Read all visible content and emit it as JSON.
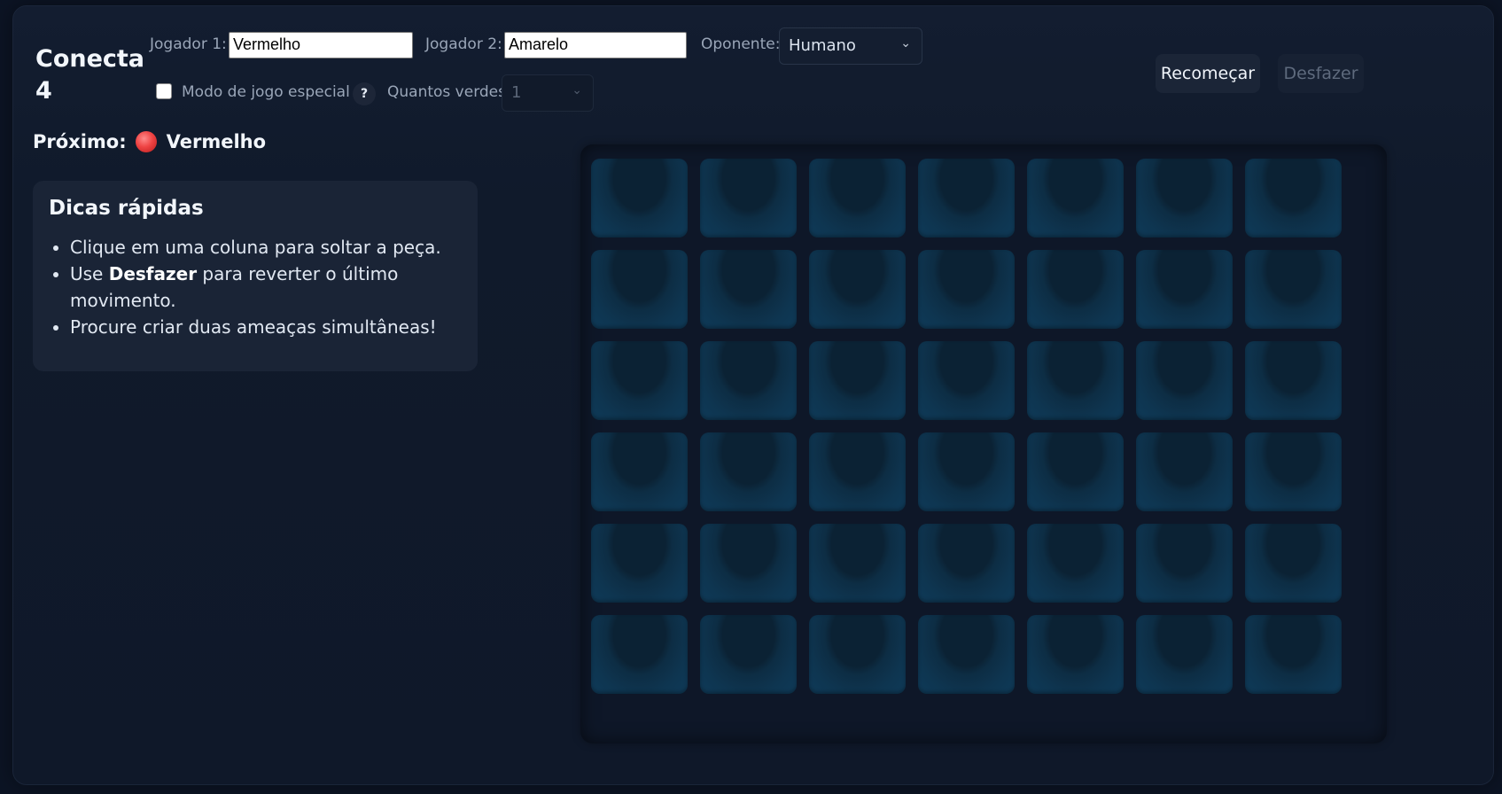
{
  "app": {
    "title": "Conecta 4"
  },
  "controls": {
    "player1_label": "Jogador 1:",
    "player1_value": "Vermelho",
    "player2_label": "Jogador 2:",
    "player2_value": "Amarelo",
    "opponent_label": "Oponente:",
    "opponent_value": "Humano",
    "special_mode_label": "Modo de jogo especial",
    "special_mode_checked": false,
    "help_label": "?",
    "greens_label": "Quantos verdes:",
    "greens_value": "1"
  },
  "buttons": {
    "restart_label": "Recomeçar",
    "undo_label": "Desfazer"
  },
  "status": {
    "next_label": "Próximo:",
    "next_player": "Vermelho",
    "next_color": "#ef4444"
  },
  "tips": {
    "title": "Dicas rápidas",
    "item1": "Clique em uma coluna para soltar a peça.",
    "item2_prefix": "Use ",
    "item2_bold": "Desfazer",
    "item2_suffix": " para reverter o último movimento.",
    "item3": "Procure criar duas ameaças simultâneas!"
  },
  "board": {
    "rows": 6,
    "columns": 7,
    "cells": [
      [
        "",
        "",
        "",
        "",
        "",
        "",
        ""
      ],
      [
        "",
        "",
        "",
        "",
        "",
        "",
        ""
      ],
      [
        "",
        "",
        "",
        "",
        "",
        "",
        ""
      ],
      [
        "",
        "",
        "",
        "",
        "",
        "",
        ""
      ],
      [
        "",
        "",
        "",
        "",
        "",
        "",
        ""
      ],
      [
        "",
        "",
        "",
        "",
        "",
        "",
        ""
      ]
    ]
  }
}
